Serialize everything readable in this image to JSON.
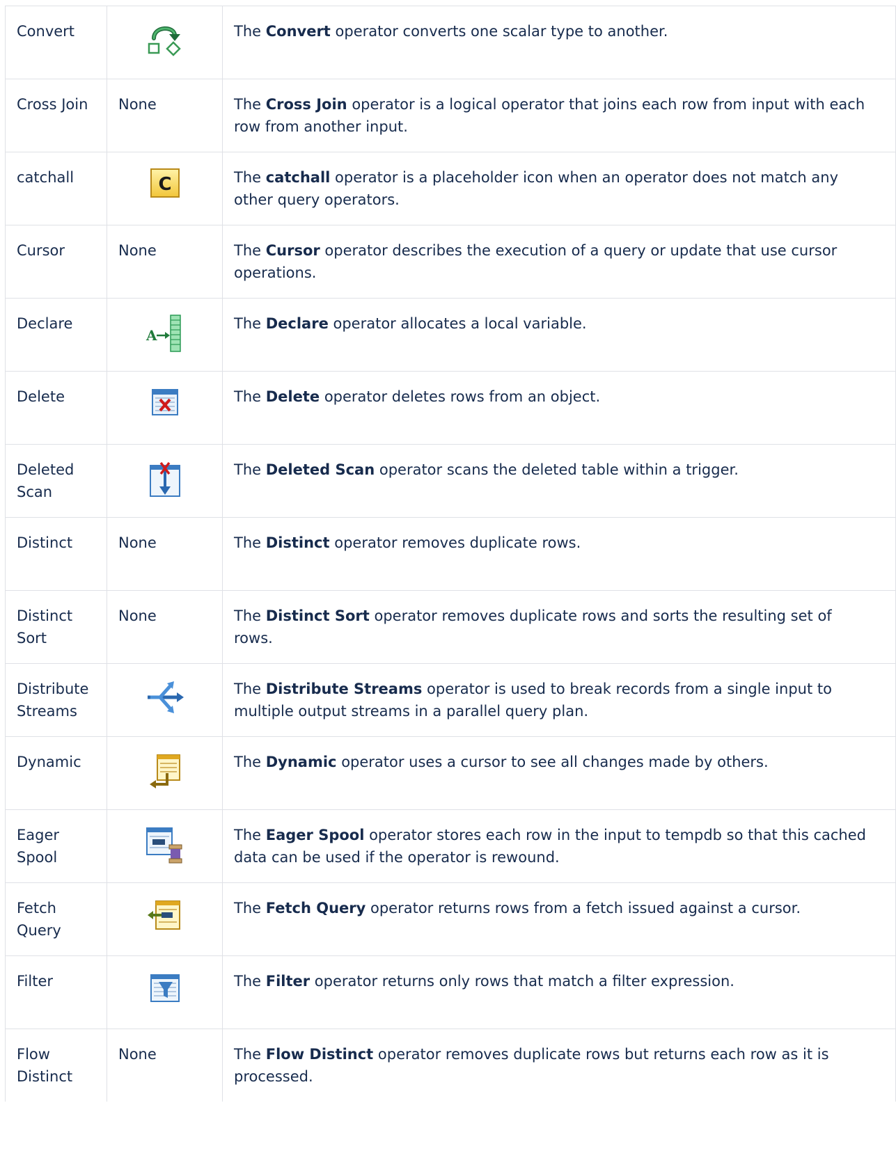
{
  "rows": [
    {
      "name": "Convert",
      "icon": "convert-icon",
      "pre": "The ",
      "bold": "Convert",
      "post": " operator converts one scalar type to another."
    },
    {
      "name": "Cross Join",
      "icon_text": "None",
      "pre": "The ",
      "bold": "Cross Join",
      "post": " operator is a logical operator that joins each row from input with each row from another input."
    },
    {
      "name": "catchall",
      "icon": "catchall-icon",
      "icon_letter": "C",
      "pre": "The ",
      "bold": "catchall",
      "post": " operator is a placeholder icon when an operator does not match any other query operators."
    },
    {
      "name": "Cursor",
      "icon_text": "None",
      "pre": "The ",
      "bold": "Cursor",
      "post": " operator describes the execution of a query or update that use cursor operations."
    },
    {
      "name": "Declare",
      "icon": "declare-icon",
      "icon_letter": "A",
      "pre": "The ",
      "bold": "Declare",
      "post": " operator allocates a local variable."
    },
    {
      "name": "Delete",
      "icon": "delete-icon",
      "pre": "The ",
      "bold": "Delete",
      "post": " operator deletes rows from an object."
    },
    {
      "name": "Deleted Scan",
      "icon": "deleted-scan-icon",
      "pre": "The ",
      "bold": "Deleted Scan",
      "post": " operator scans the deleted table within a trigger."
    },
    {
      "name": "Distinct",
      "icon_text": "None",
      "pre": "The ",
      "bold": "Distinct",
      "post": " operator removes duplicate rows."
    },
    {
      "name": "Distinct Sort",
      "icon_text": "None",
      "pre": "The ",
      "bold": "Distinct Sort",
      "post": " operator removes duplicate rows and sorts the resulting set of rows."
    },
    {
      "name": "Distribute Streams",
      "icon": "distribute-streams-icon",
      "pre": "The ",
      "bold": "Distribute Streams",
      "post": " operator is used to break records from a single input to multiple output streams in a parallel query plan."
    },
    {
      "name": "Dynamic",
      "icon": "dynamic-icon",
      "pre": "The ",
      "bold": "Dynamic",
      "post": " operator uses a cursor to see all changes made by others."
    },
    {
      "name": "Eager Spool",
      "icon": "eager-spool-icon",
      "pre": "The ",
      "bold": "Eager Spool",
      "post": " operator stores each row in the input to tempdb so that this cached data can be used if the operator is rewound."
    },
    {
      "name": "Fetch Query",
      "icon": "fetch-query-icon",
      "pre": "The ",
      "bold": "Fetch Query",
      "post": " operator returns rows from a fetch issued against a cursor."
    },
    {
      "name": "Filter",
      "icon": "filter-icon",
      "pre": "The ",
      "bold": "Filter",
      "post": " operator returns only rows that match a filter expression."
    },
    {
      "name": "Flow Distinct",
      "icon_text": "None",
      "pre": "The ",
      "bold": "Flow Distinct",
      "post": " operator removes duplicate rows but returns each row as it is processed."
    }
  ]
}
